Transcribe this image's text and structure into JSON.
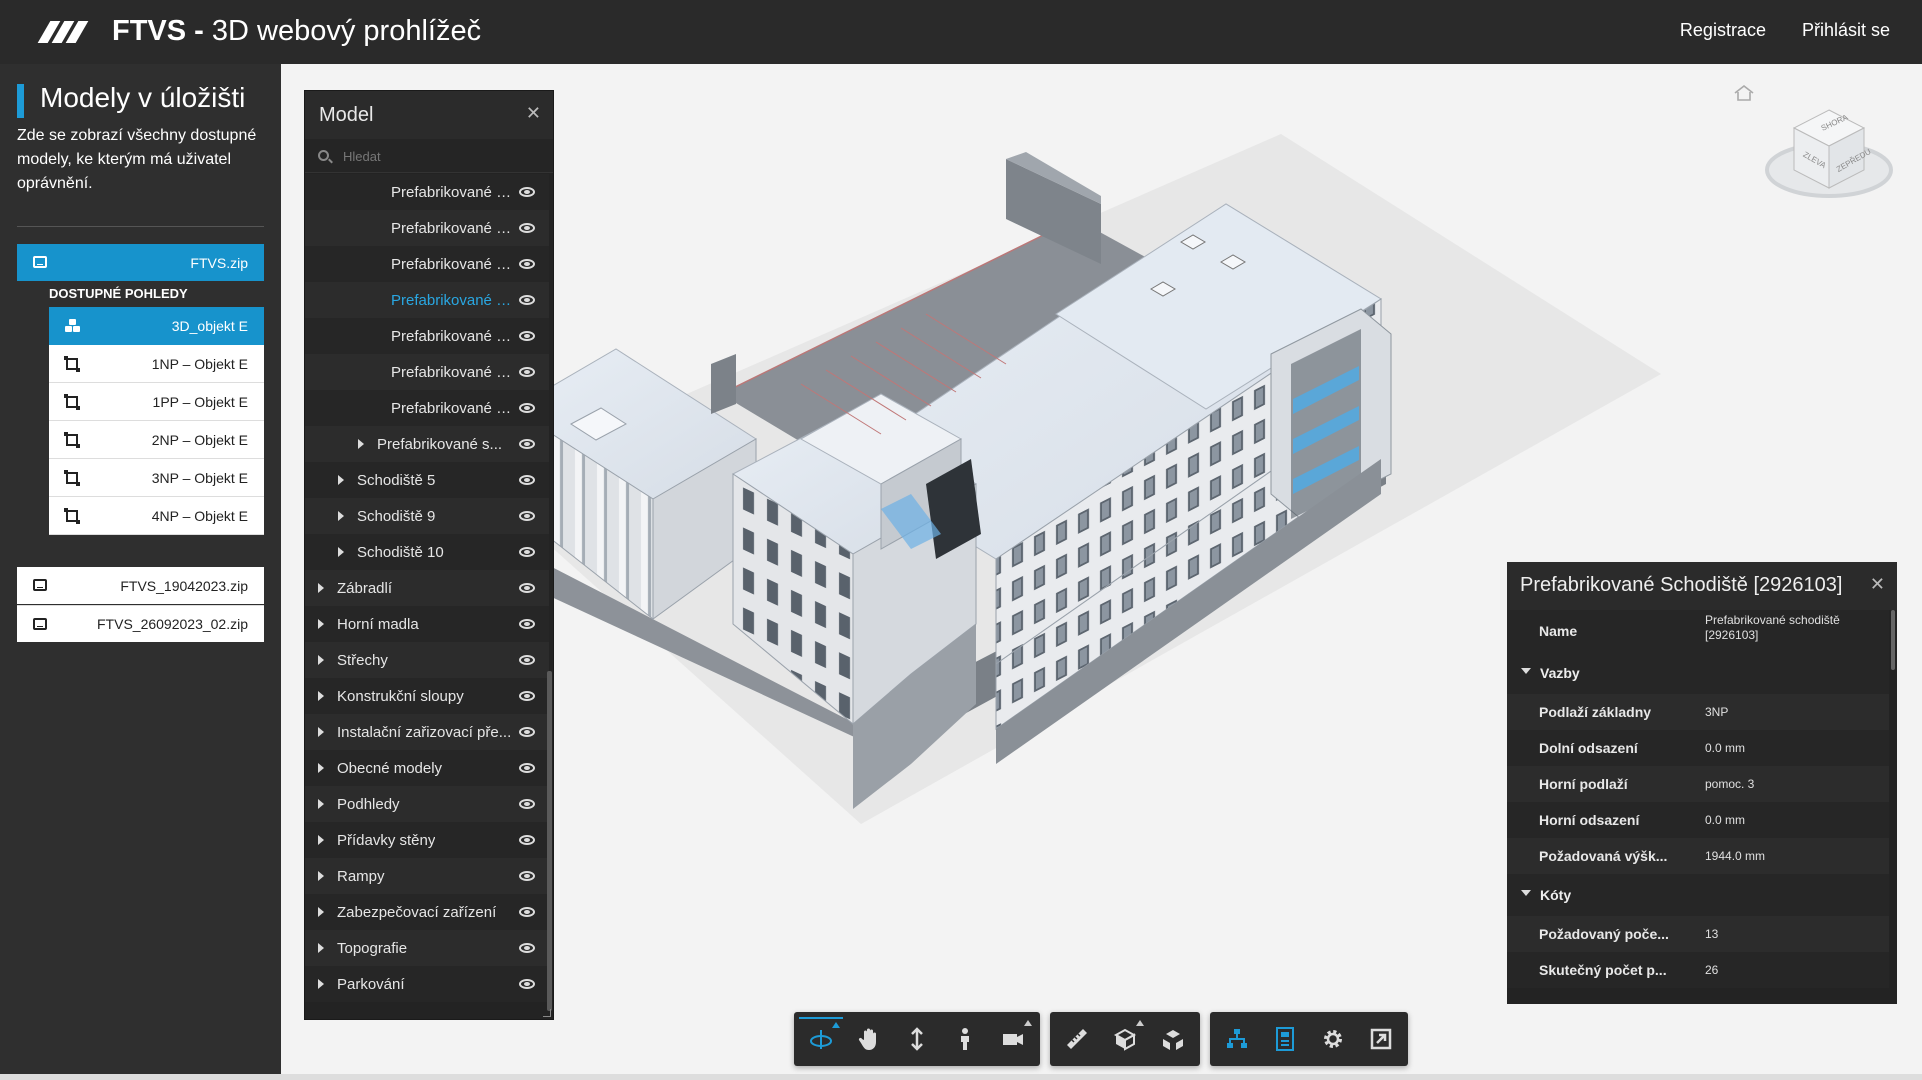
{
  "header": {
    "brand": "FTVS",
    "separator": " - ",
    "subtitle": "3D webový prohlížeč",
    "links": [
      {
        "label": "Registrace"
      },
      {
        "label": "Přihlásit se"
      }
    ]
  },
  "sidebar": {
    "title": "Modely v úložišti",
    "description": "Zde se zobrazí všechny dostupné modely, ke kterým má uživatel oprávnění.",
    "files": [
      {
        "label": "FTVS.zip",
        "active": true
      },
      {
        "label": "FTVS_19042023.zip",
        "active": false
      },
      {
        "label": "FTVS_26092023_02.zip",
        "active": false
      }
    ],
    "views_label": "DOSTUPNÉ POHLEDY",
    "views": [
      {
        "label": "3D_objekt E",
        "icon": "cubes-icon",
        "active": true
      },
      {
        "label": "1NP – Objekt E",
        "icon": "floorplan-icon"
      },
      {
        "label": "1PP – Objekt E",
        "icon": "floorplan-icon"
      },
      {
        "label": "2NP – Objekt E",
        "icon": "floorplan-icon"
      },
      {
        "label": "3NP – Objekt E",
        "icon": "floorplan-icon"
      },
      {
        "label": "4NP – Objekt E",
        "icon": "floorplan-icon"
      }
    ]
  },
  "model_panel": {
    "title": "Model",
    "search_placeholder": "Hledat",
    "rows": [
      {
        "label": "Prefabrikované s...",
        "level": 3,
        "caret": false
      },
      {
        "label": "Prefabrikované s...",
        "level": 3,
        "caret": false
      },
      {
        "label": "Prefabrikované s...",
        "level": 3,
        "caret": false
      },
      {
        "label": "Prefabrikované s...",
        "level": 3,
        "caret": false,
        "highlight": true
      },
      {
        "label": "Prefabrikované s...",
        "level": 3,
        "caret": false
      },
      {
        "label": "Prefabrikované s...",
        "level": 3,
        "caret": false
      },
      {
        "label": "Prefabrikované s...",
        "level": 3,
        "caret": false
      },
      {
        "label": "Prefabrikované s...",
        "level": 2,
        "caret": true
      },
      {
        "label": "Schodiště 5",
        "level": 1,
        "caret": true
      },
      {
        "label": "Schodiště 9",
        "level": 1,
        "caret": true
      },
      {
        "label": "Schodiště 10",
        "level": 1,
        "caret": true
      },
      {
        "label": "Zábradlí",
        "level": 0,
        "caret": true
      },
      {
        "label": "Horní madla",
        "level": 0,
        "caret": true
      },
      {
        "label": "Střechy",
        "level": 0,
        "caret": true
      },
      {
        "label": "Konstrukční sloupy",
        "level": 0,
        "caret": true
      },
      {
        "label": "Instalační zařizovací pře...",
        "level": 0,
        "caret": true
      },
      {
        "label": "Obecné modely",
        "level": 0,
        "caret": true
      },
      {
        "label": "Podhledy",
        "level": 0,
        "caret": true
      },
      {
        "label": "Přídavky stěny",
        "level": 0,
        "caret": true
      },
      {
        "label": "Rampy",
        "level": 0,
        "caret": true
      },
      {
        "label": "Zabezpečovací zařízení",
        "level": 0,
        "caret": true
      },
      {
        "label": "Topografie",
        "level": 0,
        "caret": true
      },
      {
        "label": "Parkování",
        "level": 0,
        "caret": true
      }
    ]
  },
  "properties": {
    "title": "Prefabrikované Schodiště [2926103]",
    "name_key": "Name",
    "name_value": "Prefabrikované schodiště [2926103]",
    "groups": [
      {
        "label": "Vazby",
        "rows": [
          {
            "key": "Podlaží základny",
            "value": "3NP"
          },
          {
            "key": "Dolní odsazení",
            "value": "0.0 mm"
          },
          {
            "key": "Horní podlaží",
            "value": "pomoc. 3"
          },
          {
            "key": "Horní odsazení",
            "value": "0.0 mm"
          },
          {
            "key": "Požadovaná výšk...",
            "value": "1944.0 mm"
          }
        ]
      },
      {
        "label": "Kóty",
        "rows": [
          {
            "key": "Požadovaný poče...",
            "value": "13"
          },
          {
            "key": "Skutečný počet p...",
            "value": "26"
          }
        ]
      }
    ]
  },
  "viewcube": {
    "faces": [
      "SHORA",
      "ZLEVA",
      "ZEPŘEDU"
    ]
  },
  "toolbar": {
    "groups": [
      [
        "orbit-icon",
        "pan-icon",
        "zoom-icon",
        "first-person-icon",
        "camera-icon"
      ],
      [
        "measure-icon",
        "section-icon",
        "explode-icon"
      ],
      [
        "model-browser-icon",
        "properties-icon",
        "settings-icon",
        "fullscreen-icon"
      ]
    ]
  },
  "colors": {
    "accent": "#1793cc",
    "header_bg": "#2a2a2a",
    "panel_bg": "#232323",
    "highlight_text": "#29a7e2"
  }
}
